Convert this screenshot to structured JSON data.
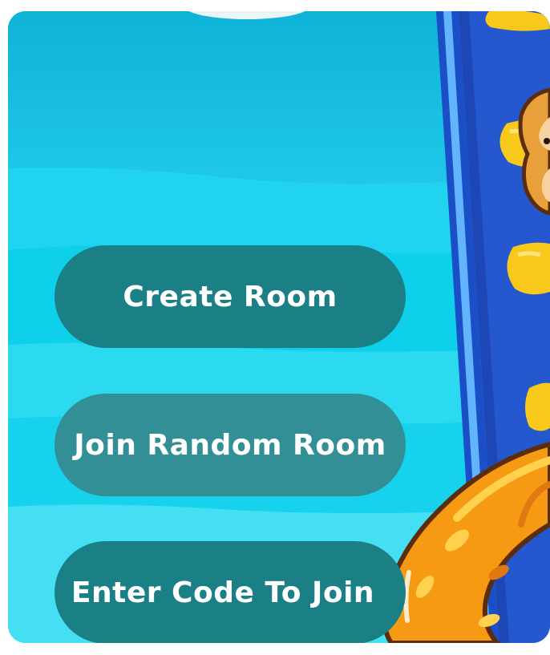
{
  "menu": {
    "create_room_label": "Create Room",
    "join_random_label": "Join Random Room",
    "enter_code_label": "Enter Code To Join"
  },
  "colors": {
    "water_light": "#5ee4f2",
    "water_mid": "#12cce6",
    "water_dark": "#0fb8d8",
    "button_primary": "#1b7f86",
    "button_secondary": "#338f96",
    "ladder_blue": "#1642b8",
    "ladder_rail": "#5aa9ff",
    "rung_yellow": "#f8c81a",
    "snake_orange": "#f59a12",
    "monkey_brown": "#e8a13a"
  },
  "artwork": {
    "ladder": "ladder-illustration",
    "snake": "snake-illustration",
    "monkey": "monkey-illustration"
  }
}
